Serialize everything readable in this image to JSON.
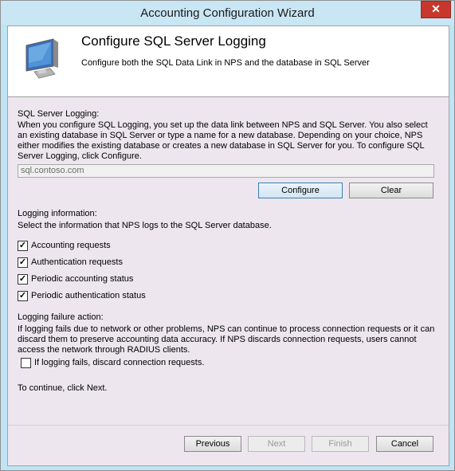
{
  "window": {
    "title": "Accounting Configuration Wizard",
    "close_glyph": "✕"
  },
  "header": {
    "title": "Configure SQL Server Logging",
    "subtitle": "Configure both the SQL Data Link in NPS and the database in SQL Server",
    "icon": "monitor-icon"
  },
  "sql_logging": {
    "label": "SQL Server Logging:",
    "description": "When you configure SQL Logging, you set up the data link between NPS and SQL Server. You also select an existing database in SQL Server or type a name for a new database. Depending on your choice, NPS either modifies the existing database or creates a new database in SQL Server for you. To configure SQL Server Logging, click Configure.",
    "server_value": "sql.contoso.com",
    "configure_label": "Configure",
    "clear_label": "Clear"
  },
  "logging_info": {
    "label": "Logging information:",
    "description": "Select the information that NPS logs to the SQL Server database.",
    "options": [
      {
        "label": "Accounting requests",
        "checked": true
      },
      {
        "label": "Authentication requests",
        "checked": true
      },
      {
        "label": "Periodic accounting status",
        "checked": true
      },
      {
        "label": "Periodic authentication status",
        "checked": true
      }
    ]
  },
  "failure_action": {
    "label": "Logging failure action:",
    "description": "If logging fails due to network or other problems, NPS can continue to process connection requests or it can discard them to preserve accounting data accuracy. If NPS discards connection requests, users cannot access the network through RADIUS clients.",
    "discard_label": "If logging fails, discard connection requests.",
    "discard_checked": false
  },
  "continue_text": "To continue, click Next.",
  "footer": {
    "previous_label": "Previous",
    "next_label": "Next",
    "finish_label": "Finish",
    "cancel_label": "Cancel"
  },
  "colors": {
    "client_bg": "#ede6ef",
    "titlebar_bg": "#c9e6f5",
    "close_red": "#c7372b"
  }
}
